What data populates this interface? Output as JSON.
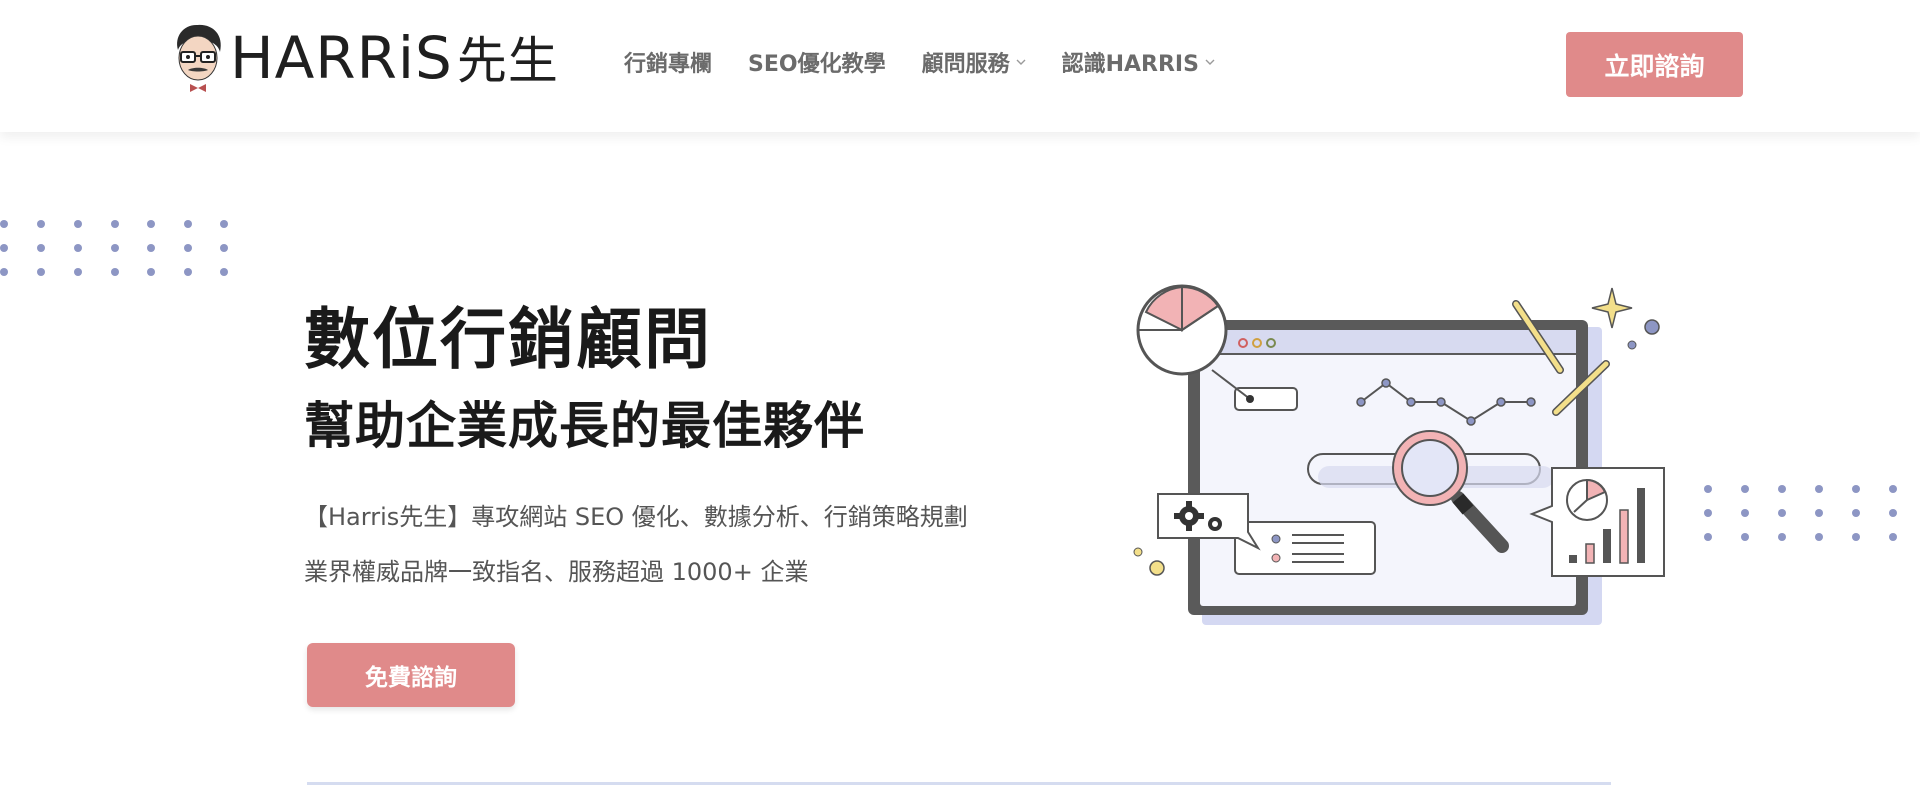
{
  "header": {
    "logo_text": "HARRiS",
    "logo_cn": "先生",
    "nav": [
      {
        "label": "行銷專欄",
        "has_dropdown": false
      },
      {
        "label": "SEO優化教學",
        "has_dropdown": false
      },
      {
        "label": "顧問服務",
        "has_dropdown": true
      },
      {
        "label": "認識HARRIS",
        "has_dropdown": true
      }
    ],
    "cta_label": "立即諮詢"
  },
  "hero": {
    "title": "數位行銷顧問",
    "subtitle": "幫助企業成長的最佳夥伴",
    "desc_line1": "【Harris先生】專攻網站 SEO 優化、數據分析、行銷策略規劃",
    "desc_line2": "業界權威品牌一致指名、服務超過 1000+ 企業",
    "cta_label": "免費諮詢"
  },
  "colors": {
    "accent": "#e08a8a",
    "dots": "#8d96c4",
    "pink": "#f2b3b5",
    "lavender": "#d4d8f2",
    "yellow": "#f3df8a",
    "dark": "#555555"
  },
  "icons": [
    "avatar-icon",
    "chevron-down-icon",
    "pie-chart-icon",
    "magnifier-icon",
    "gears-icon",
    "bar-chart-icon",
    "sparkle-icon"
  ]
}
